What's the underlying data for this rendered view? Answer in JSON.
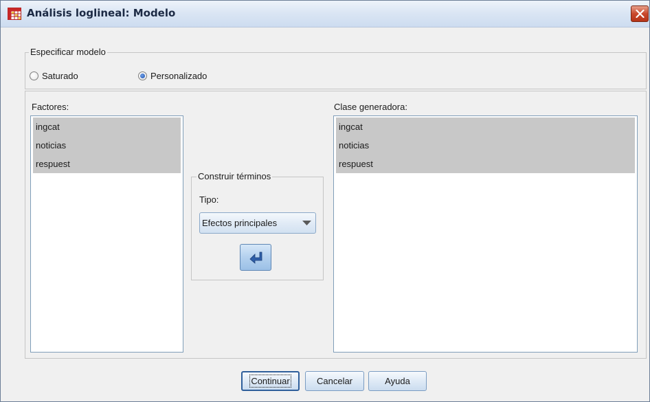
{
  "window": {
    "title": "Análisis loglineal: Modelo"
  },
  "model_group": {
    "legend": "Especificar modelo",
    "options": [
      {
        "label": "Saturado",
        "checked": false
      },
      {
        "label": "Personalizado",
        "checked": true
      }
    ]
  },
  "factors": {
    "label": "Factores:",
    "items": [
      "ingcat",
      "noticias",
      "respuest"
    ]
  },
  "generating_class": {
    "label": "Clase generadora:",
    "items": [
      "ingcat",
      "noticias",
      "respuest"
    ]
  },
  "build_terms": {
    "legend": "Construir términos",
    "type_label": "Tipo:",
    "type_value": "Efectos principales"
  },
  "buttons": {
    "continue": "Continuar",
    "cancel": "Cancelar",
    "help": "Ayuda"
  },
  "colors": {
    "selection": "#c8c8c8",
    "dialog_bg": "#f0f0f0",
    "close_button": "#c9482c"
  },
  "icons": {
    "app": "spss-data-grid-icon",
    "close": "close-icon",
    "move": "arrow-left-icon",
    "dropdown": "chevron-down-icon"
  }
}
